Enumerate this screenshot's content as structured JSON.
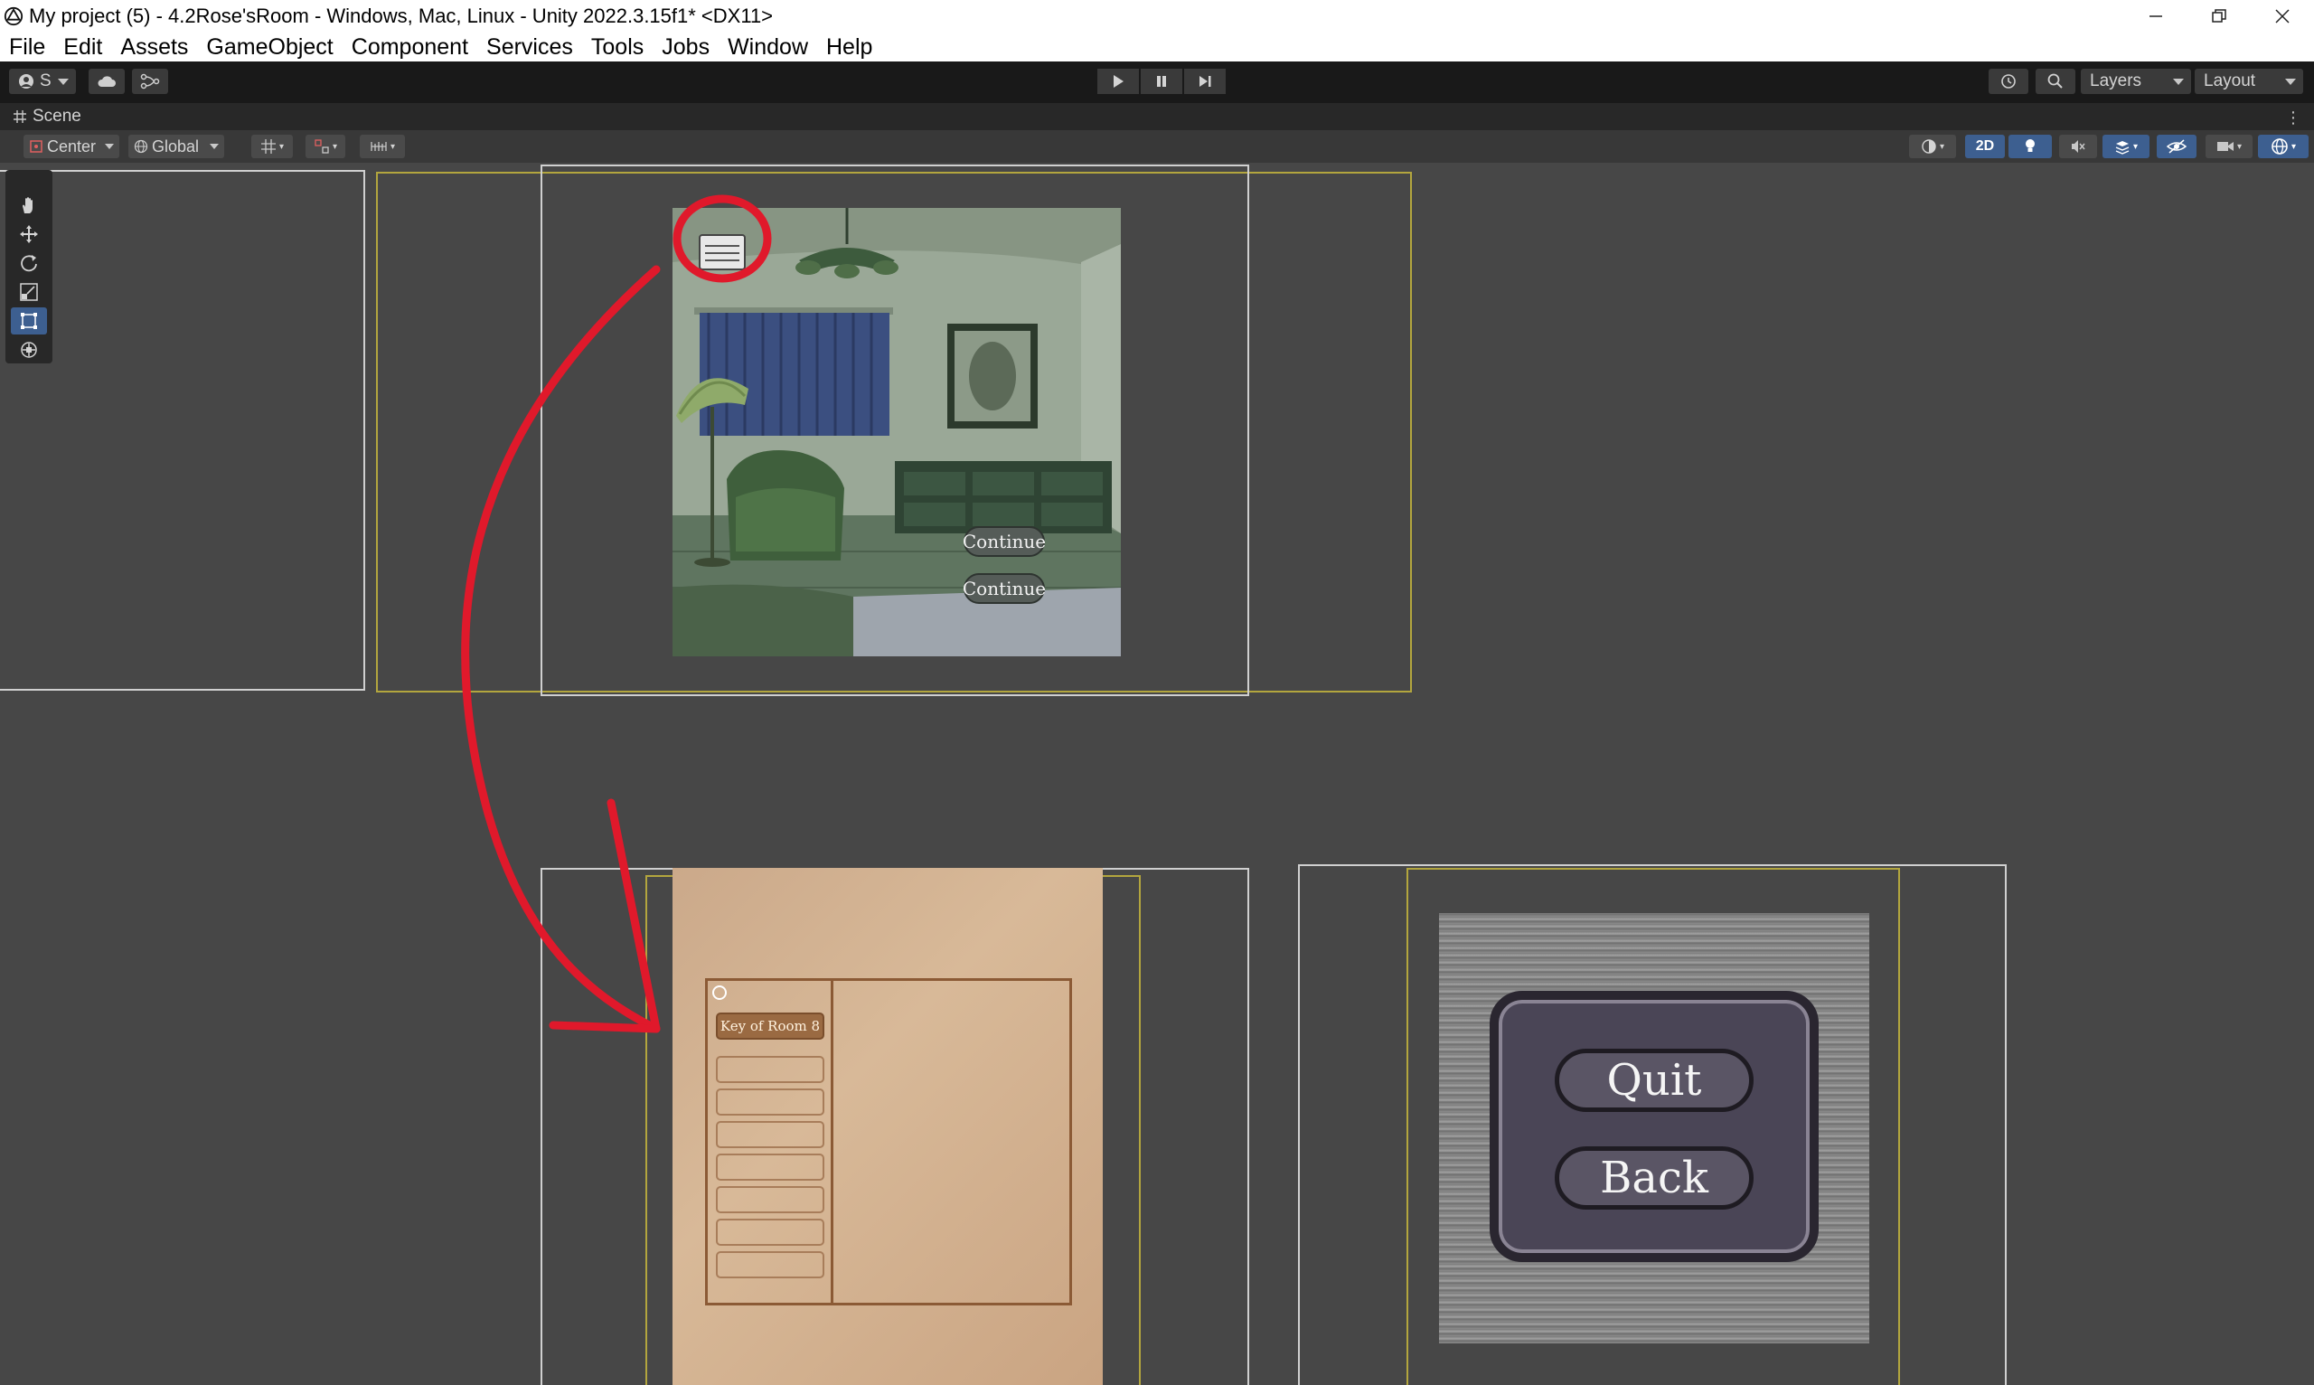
{
  "window": {
    "title": "My project (5) - 4.2Rose'sRoom - Windows, Mac, Linux - Unity 2022.3.15f1* <DX11>"
  },
  "menu": [
    "File",
    "Edit",
    "Assets",
    "GameObject",
    "Component",
    "Services",
    "Tools",
    "Jobs",
    "Window",
    "Help"
  ],
  "toolbar": {
    "account_label": "S",
    "layers_label": "Layers",
    "layout_label": "Layout"
  },
  "scene": {
    "tab_label": "Scene",
    "pivot_label": "Center",
    "space_label": "Global",
    "mode_2d_label": "2D"
  },
  "room": {
    "continue_1": "Continue",
    "continue_2": "Continue"
  },
  "journal": {
    "item_1": "Key of Room 8"
  },
  "pause_menu": {
    "quit_label": "Quit",
    "back_label": "Back"
  },
  "colors": {
    "accent_blue": "#3d5f90",
    "annotation_red": "#e0192b",
    "canvas_yellow": "#b3a63e"
  }
}
